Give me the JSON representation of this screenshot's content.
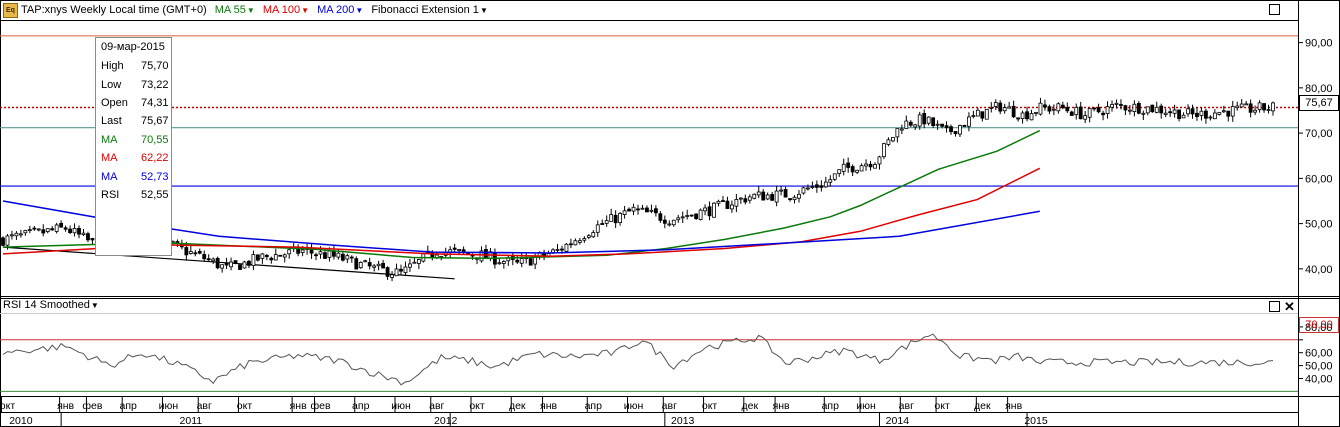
{
  "header": {
    "logo_label": "Eq",
    "instrument": "TAP:xnys Weekly Local time (GMT+0)",
    "indicators": [
      {
        "label": "MA 55",
        "color": "#0a7a0a"
      },
      {
        "label": "MA 100",
        "color": "#e00000"
      },
      {
        "label": "MA 200",
        "color": "#0000dd"
      },
      {
        "label": "Fibonacci Extension 1",
        "color": "#000000"
      }
    ]
  },
  "info_box": {
    "date": "09-мар-2015",
    "rows": [
      {
        "key": "High",
        "value": "75,70",
        "color": "#000000"
      },
      {
        "key": "Low",
        "value": "73,22",
        "color": "#000000"
      },
      {
        "key": "Open",
        "value": "74,31",
        "color": "#000000"
      },
      {
        "key": "Last",
        "value": "75,67",
        "color": "#000000"
      },
      {
        "key": "MA",
        "value": "70,55",
        "color": "#0a7a0a"
      },
      {
        "key": "MA",
        "value": "62,22",
        "color": "#e00000"
      },
      {
        "key": "MA",
        "value": "52,73",
        "color": "#0000dd"
      },
      {
        "key": "RSI",
        "value": "52,55",
        "color": "#000000"
      }
    ]
  },
  "rsi_panel": {
    "title": "RSI 14 Smoothed",
    "overbought_label": "70,00"
  },
  "price_axis": {
    "current_label": "75,67"
  },
  "chart_data": [
    {
      "type": "candlestick",
      "title": "TAP:xnys Weekly",
      "ylim": [
        34,
        95
      ],
      "y_ticks": [
        40,
        50,
        60,
        70,
        80,
        90
      ],
      "y_tick_labels": [
        "40,00",
        "50,00",
        "60,00",
        "70,00",
        "80,00",
        "90,00"
      ],
      "horizontal_lines": [
        {
          "value": 91.5,
          "color": "#e07050"
        },
        {
          "value": 75.67,
          "color": "#cc0000",
          "style": "dotted"
        },
        {
          "value": 71.2,
          "color": "#5a9a9a"
        },
        {
          "value": 58.3,
          "color": "#0000dd"
        }
      ],
      "trendline": [
        {
          "date": "2009-09-28",
          "value": 44.8
        },
        {
          "date": "2011-09-05",
          "value": 37.8
        }
      ],
      "close_anchors": [
        [
          "2009-09-28",
          46.5
        ],
        [
          "2010-01-04",
          49
        ],
        [
          "2010-03-01",
          44.5
        ],
        [
          "2010-04-26",
          46.5
        ],
        [
          "2010-06-21",
          45
        ],
        [
          "2010-08-16",
          42
        ],
        [
          "2010-09-13",
          40
        ],
        [
          "2010-11-08",
          42.5
        ],
        [
          "2011-01-10",
          44
        ],
        [
          "2011-03-07",
          42.5
        ],
        [
          "2011-05-02",
          40
        ],
        [
          "2011-06-13",
          39
        ],
        [
          "2011-08-08",
          44
        ],
        [
          "2011-10-17",
          43
        ],
        [
          "2011-12-12",
          41
        ],
        [
          "2012-02-13",
          44
        ],
        [
          "2012-04-09",
          49
        ],
        [
          "2012-06-11",
          53
        ],
        [
          "2012-08-06",
          51
        ],
        [
          "2012-10-08",
          53
        ],
        [
          "2012-12-10",
          56
        ],
        [
          "2013-02-11",
          56.5
        ],
        [
          "2013-04-08",
          59
        ],
        [
          "2013-05-06",
          62
        ],
        [
          "2013-06-24",
          64
        ],
        [
          "2013-08-05",
          72
        ],
        [
          "2013-09-09",
          73
        ],
        [
          "2013-10-14",
          70
        ],
        [
          "2013-12-02",
          74
        ],
        [
          "2014-01-06",
          76
        ],
        [
          "2014-02-10",
          74
        ],
        [
          "2014-03-10",
          75.5
        ],
        [
          "2014-04-14",
          75.5
        ],
        [
          "2014-05-19",
          74
        ],
        [
          "2014-07-07",
          76
        ],
        [
          "2014-09-01",
          75.5
        ],
        [
          "2014-11-03",
          74
        ],
        [
          "2015-01-05",
          75
        ],
        [
          "2015-03-09",
          75.67
        ]
      ],
      "series": [
        {
          "name": "MA 55",
          "color": "#0a7a0a",
          "points": [
            [
              "2009-09-28",
              44.8
            ],
            [
              "2010-06-01",
              45.8
            ],
            [
              "2011-02-01",
              44.3
            ],
            [
              "2011-07-01",
              42.5
            ],
            [
              "2011-11-01",
              42.3
            ],
            [
              "2012-05-01",
              43
            ],
            [
              "2012-08-01",
              44.5
            ],
            [
              "2012-11-01",
              46.5
            ],
            [
              "2013-02-01",
              49
            ],
            [
              "2013-04-15",
              51.5
            ],
            [
              "2013-06-01",
              54
            ],
            [
              "2013-08-01",
              58
            ],
            [
              "2013-10-01",
              62
            ],
            [
              "2014-01-01",
              66
            ],
            [
              "2014-03-09",
              70.55
            ]
          ]
        },
        {
          "name": "MA 100",
          "color": "#e00000",
          "points": [
            [
              "2009-09-28",
              43.3
            ],
            [
              "2010-06-01",
              45.3
            ],
            [
              "2011-01-01",
              44.8
            ],
            [
              "2011-08-01",
              43.3
            ],
            [
              "2012-02-01",
              42.8
            ],
            [
              "2012-06-01",
              43.3
            ],
            [
              "2012-11-01",
              44.5
            ],
            [
              "2013-03-01",
              46
            ],
            [
              "2013-06-01",
              48.3
            ],
            [
              "2013-09-01",
              52
            ],
            [
              "2013-12-01",
              55.3
            ],
            [
              "2014-03-09",
              62.22
            ]
          ]
        },
        {
          "name": "MA 200",
          "color": "#0000dd",
          "points": [
            [
              "2009-09-28",
              55
            ],
            [
              "2010-03-01",
              51.2
            ],
            [
              "2010-09-01",
              47.2
            ],
            [
              "2011-03-01",
              45.2
            ],
            [
              "2011-08-01",
              43.7
            ],
            [
              "2012-02-01",
              43.5
            ],
            [
              "2012-08-01",
              44.2
            ],
            [
              "2013-02-01",
              45.7
            ],
            [
              "2013-08-01",
              47.2
            ],
            [
              "2014-03-09",
              52.73
            ]
          ]
        }
      ],
      "x_labels": [
        "окт",
        "янв",
        "фев",
        "апр",
        "июн",
        "авг",
        "окт",
        "янв",
        "фев",
        "апр",
        "июн",
        "авг",
        "окт",
        "дек",
        "янв",
        "апр",
        "июн",
        "авг",
        "окт",
        "дек",
        "янв",
        "апр",
        "июн",
        "авг",
        "окт",
        "дек",
        "янв"
      ],
      "x_label_dates": [
        "2009-10-05",
        "2010-01-04",
        "2010-02-15",
        "2010-04-12",
        "2010-06-14",
        "2010-08-09",
        "2010-10-11",
        "2011-01-03",
        "2011-02-07",
        "2011-04-11",
        "2011-06-13",
        "2011-08-08",
        "2011-10-10",
        "2011-12-12",
        "2012-01-30",
        "2012-04-09",
        "2012-06-11",
        "2012-08-06",
        "2012-10-08",
        "2012-12-10",
        "2013-01-28",
        "2013-04-15",
        "2013-06-10",
        "2013-08-12",
        "2013-10-07",
        "2013-12-09",
        "2014-01-27"
      ],
      "year_labels": [
        [
          "2010",
          "2009-10-26"
        ],
        [
          "2011",
          "2010-07-19"
        ],
        [
          "2012",
          "2011-08-22"
        ],
        [
          "2013",
          "2012-08-27"
        ],
        [
          "2014",
          "2013-07-29"
        ],
        [
          "2015",
          "2014-03-03"
        ]
      ]
    },
    {
      "type": "line",
      "title": "RSI 14 Smoothed",
      "ylim": [
        28,
        90
      ],
      "y_ticks": [
        40,
        50,
        60,
        70,
        80
      ],
      "y_tick_labels": [
        "40,00",
        "50,00",
        "60,00",
        "70,00",
        "80,00"
      ],
      "levels": [
        {
          "value": 70,
          "color": "#cc3333"
        },
        {
          "value": 30,
          "color": "#3a8a3a"
        }
      ],
      "series": [
        {
          "name": "RSI",
          "color": "#555555",
          "points": [
            [
              "2009-09-28",
              60
            ],
            [
              "2010-01-04",
              65
            ],
            [
              "2010-03-15",
              50
            ],
            [
              "2010-05-03",
              60
            ],
            [
              "2010-07-05",
              50
            ],
            [
              "2010-08-23",
              38
            ],
            [
              "2010-10-18",
              52
            ],
            [
              "2011-01-03",
              58
            ],
            [
              "2011-03-07",
              54
            ],
            [
              "2011-05-02",
              44
            ],
            [
              "2011-06-20",
              37
            ],
            [
              "2011-08-15",
              56
            ],
            [
              "2011-09-26",
              54
            ],
            [
              "2011-11-07",
              49
            ],
            [
              "2012-01-09",
              59
            ],
            [
              "2012-03-12",
              57
            ],
            [
              "2012-05-14",
              60
            ],
            [
              "2012-06-25",
              70
            ],
            [
              "2012-08-13",
              50
            ],
            [
              "2012-10-01",
              64
            ],
            [
              "2012-12-24",
              72
            ],
            [
              "2013-02-04",
              52
            ],
            [
              "2013-03-18",
              56
            ],
            [
              "2013-05-06",
              62
            ],
            [
              "2013-07-01",
              54
            ],
            [
              "2013-08-19",
              67
            ],
            [
              "2013-09-16",
              74
            ],
            [
              "2013-10-07",
              70
            ],
            [
              "2013-11-04",
              57
            ],
            [
              "2013-12-30",
              54
            ],
            [
              "2014-02-03",
              57
            ],
            [
              "2014-03-09",
              52.55
            ]
          ]
        }
      ]
    }
  ]
}
